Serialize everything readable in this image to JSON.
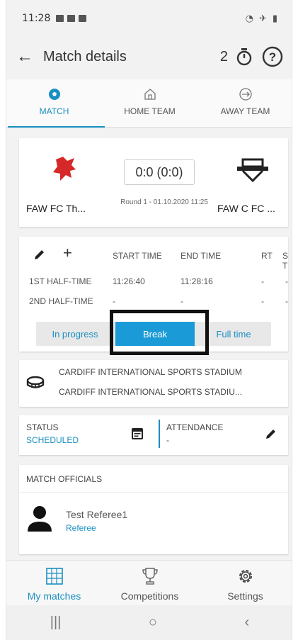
{
  "status_bar": {
    "time": "11:28"
  },
  "app_bar": {
    "title": "Match details",
    "counter": "2"
  },
  "tabs": [
    {
      "label": "MATCH",
      "icon": "football-icon",
      "active": true
    },
    {
      "label": "HOME TEAM",
      "icon": "home-icon",
      "active": false
    },
    {
      "label": "AWAY TEAM",
      "icon": "plane-icon",
      "active": false
    }
  ],
  "match": {
    "home_team": "FAW FC Th...",
    "away_team": "FAW C FC ...",
    "score": "0:0 (0:0)",
    "round_info": "Round 1 - 01.10.2020 11:25"
  },
  "times": {
    "headers": {
      "start": "START TIME",
      "end": "END TIME",
      "rt": "RT",
      "s": "S T"
    },
    "rows": [
      {
        "label": "1ST HALF-TIME",
        "start": "11:26:40",
        "end": "11:28:16",
        "rt": "-",
        "s": "-"
      },
      {
        "label": "2ND HALF-TIME",
        "start": "-",
        "end": "-",
        "rt": "-",
        "s": "-"
      }
    ],
    "buttons": {
      "in_progress": "In progress",
      "break": "Break",
      "full_time": "Full time"
    }
  },
  "venue": {
    "line1": "CARDIFF INTERNATIONAL SPORTS STADIUM",
    "line2": "CARDIFF INTERNATIONAL SPORTS STADIU..."
  },
  "status": {
    "label": "STATUS",
    "value": "SCHEDULED",
    "attendance_label": "ATTENDANCE",
    "attendance_value": "-"
  },
  "officials": {
    "title": "MATCH OFFICIALS",
    "name": "Test Referee1",
    "role": "Referee"
  },
  "bottom_nav": [
    {
      "label": "My matches",
      "icon": "calendar-grid-icon",
      "active": true
    },
    {
      "label": "Competitions",
      "icon": "trophy-icon",
      "active": false
    },
    {
      "label": "Settings",
      "icon": "gear-icon",
      "active": false
    }
  ],
  "colors": {
    "accent": "#1a8fc2",
    "break_button": "#1a9bd7"
  }
}
